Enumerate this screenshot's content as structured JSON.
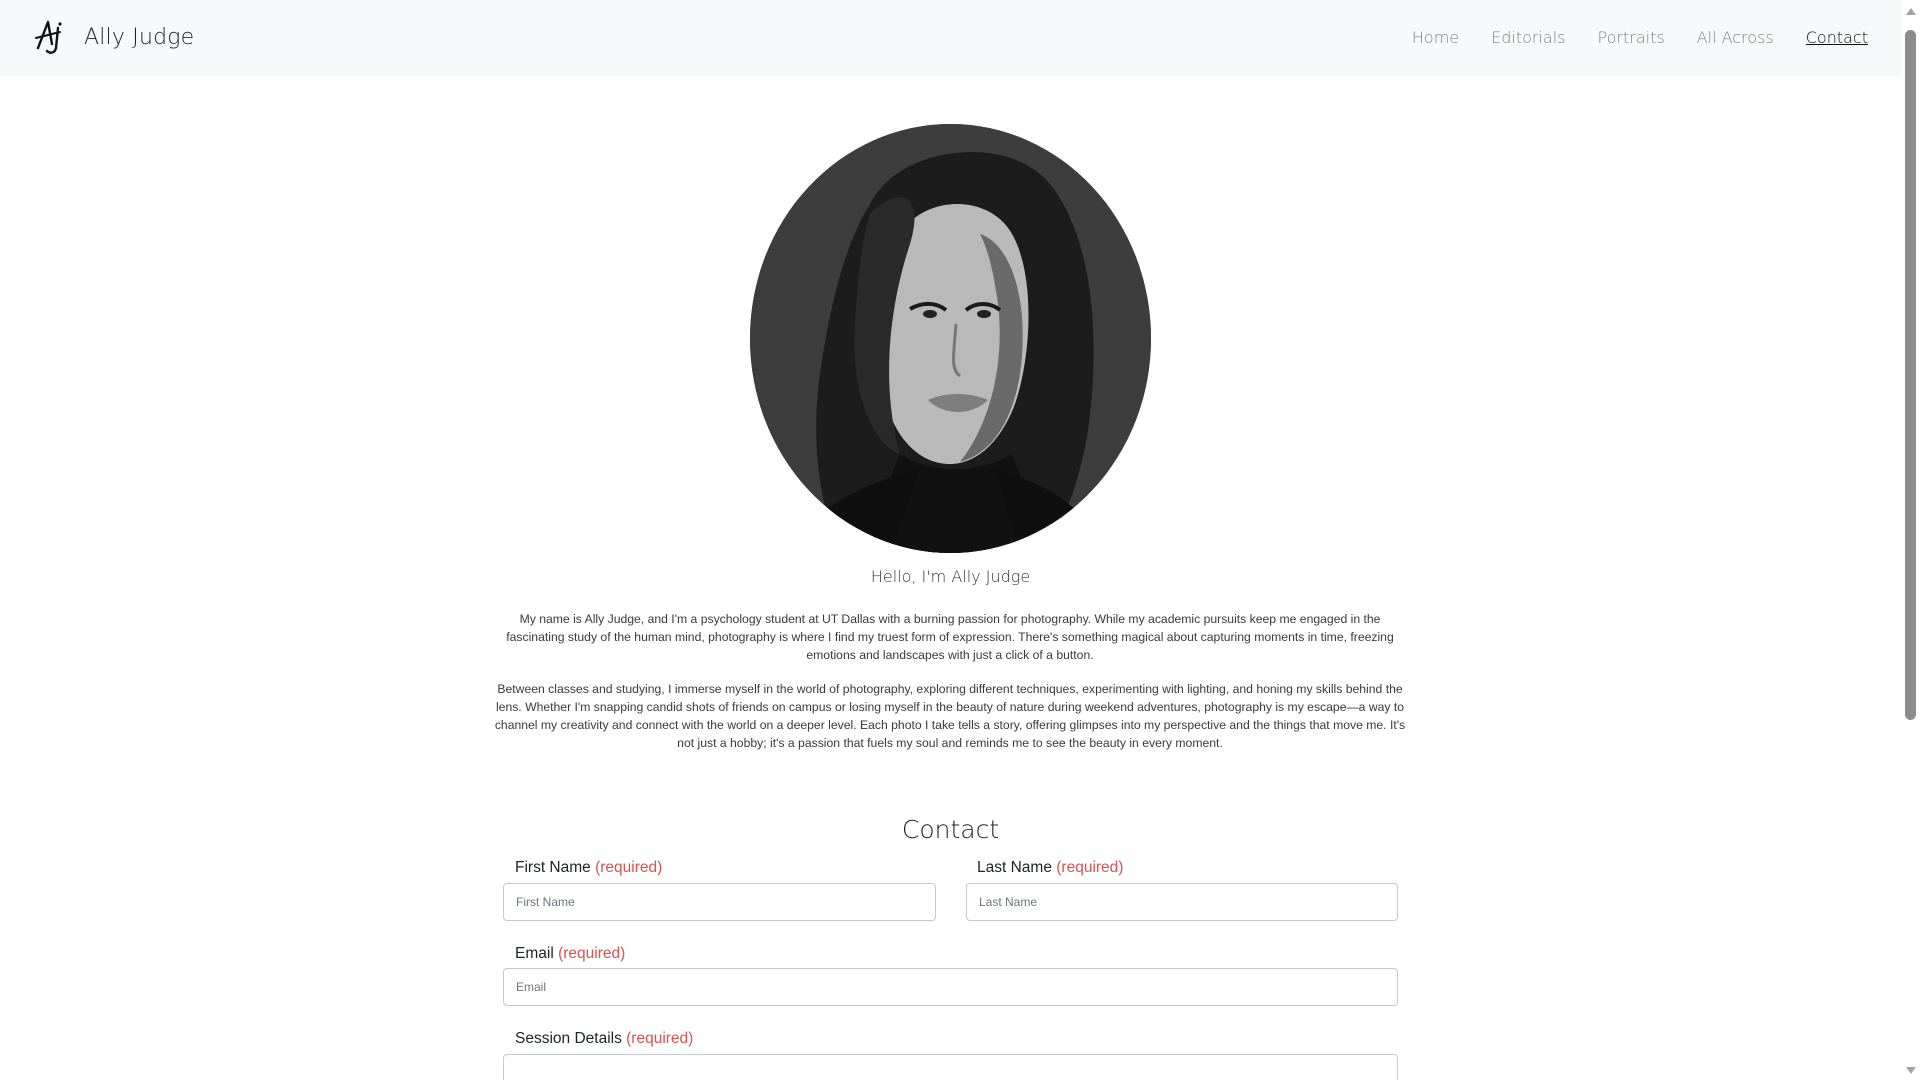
{
  "brand": {
    "name": "Ally Judge",
    "logo": "AJ-signature-logo"
  },
  "nav": {
    "items": [
      {
        "label": "Home",
        "active": false
      },
      {
        "label": "Editorials",
        "active": false
      },
      {
        "label": "Portraits",
        "active": false
      },
      {
        "label": "All Across",
        "active": false
      },
      {
        "label": "Contact",
        "active": true
      }
    ]
  },
  "about": {
    "greeting": "Hello, I'm Ally Judge",
    "paragraph1": "My name is Ally Judge, and I'm a psychology student at UT Dallas with a burning passion for photography. While my academic pursuits keep me engaged in the fascinating study of the human mind, photography is where I find my truest form of expression. There's something magical about capturing moments in time, freezing emotions and landscapes with just a click of a button.",
    "paragraph2": "Between classes and studying, I immerse myself in the world of photography, exploring different techniques, experimenting with lighting, and honing my skills behind the lens. Whether I'm snapping candid shots of friends on campus or losing myself in the beauty of nature during weekend adventures, photography is my escape—a way to channel my creativity and connect with the world on a deeper level. Each photo I take tells a story, offering glimpses into my perspective and the things that move me. It's not just a hobby; it's a passion that fuels my soul and reminds me to see the beauty in every moment."
  },
  "contact": {
    "title": "Contact",
    "required_text": "(required)",
    "first_name": {
      "label": "First Name",
      "placeholder": "First Name",
      "value": ""
    },
    "last_name": {
      "label": "Last Name",
      "placeholder": "Last Name",
      "value": ""
    },
    "email": {
      "label": "Email",
      "placeholder": "Email",
      "value": ""
    },
    "session_details": {
      "label": "Session Details",
      "value": ""
    }
  },
  "colors": {
    "required": "#d9534f",
    "navbar_bg": "#f8f9fa",
    "nav_link": "#808080"
  }
}
